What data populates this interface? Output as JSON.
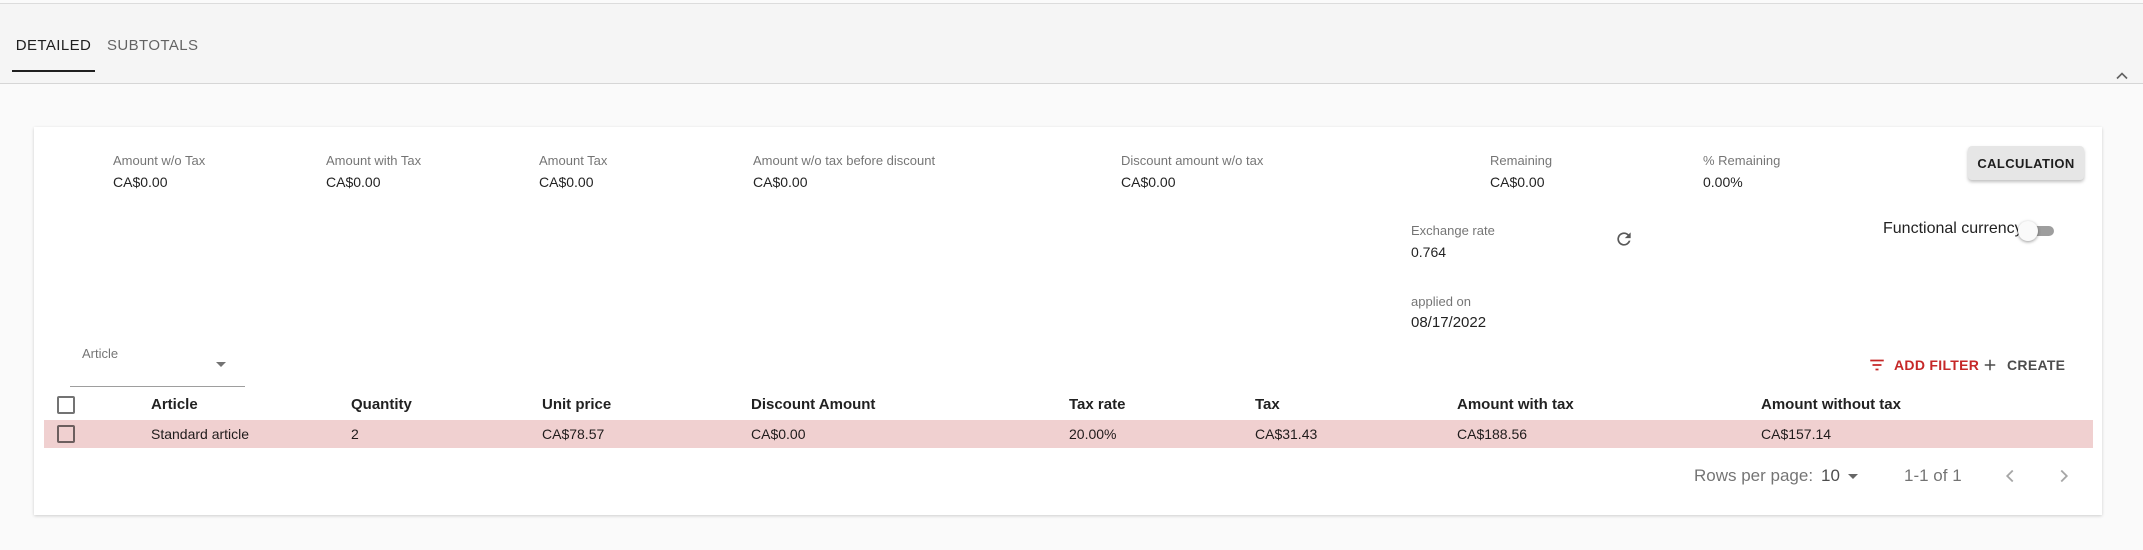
{
  "tabs": [
    {
      "label": "DETAILED",
      "active": true
    },
    {
      "label": "SUBTOTALS",
      "active": false
    }
  ],
  "summary": [
    {
      "label": "Amount w/o Tax",
      "value": "CA$0.00"
    },
    {
      "label": "Amount with Tax",
      "value": "CA$0.00"
    },
    {
      "label": "Amount Tax",
      "value": "CA$0.00"
    },
    {
      "label": "Amount w/o tax before discount",
      "value": "CA$0.00"
    },
    {
      "label": "Discount amount w/o tax",
      "value": "CA$0.00"
    },
    {
      "label": "Remaining",
      "value": "CA$0.00"
    },
    {
      "label": "% Remaining",
      "value": "0.00%"
    }
  ],
  "calculation_button": "CALCULATION",
  "exchange_rate": {
    "label": "Exchange rate",
    "value": "0.764"
  },
  "applied_on": {
    "label": "applied on",
    "value": "08/17/2022"
  },
  "functional_currency": {
    "label": "Functional currency",
    "enabled": false
  },
  "article_filter": {
    "label": "Article"
  },
  "toolbar": {
    "add_filter": "ADD FILTER",
    "create": "CREATE"
  },
  "table": {
    "columns": [
      "Article",
      "Quantity",
      "Unit price",
      "Discount Amount",
      "Tax rate",
      "Tax",
      "Amount with tax",
      "Amount without tax"
    ],
    "rows": [
      [
        "Standard article",
        "2",
        "CA$78.57",
        "CA$0.00",
        "20.00%",
        "CA$31.43",
        "CA$188.56",
        "CA$157.14"
      ]
    ]
  },
  "pagination": {
    "rows_per_page_label": "Rows per page:",
    "rows_per_page": "10",
    "range": "1-1 of 1"
  },
  "colors": {
    "accent": "#c62828",
    "selected_row": "#f0d0d0"
  },
  "icons": [
    "chevron-up-icon",
    "refresh-icon",
    "filter-icon",
    "plus-icon",
    "chevron-left-icon",
    "chevron-right-icon",
    "dropdown-arrow-icon"
  ]
}
